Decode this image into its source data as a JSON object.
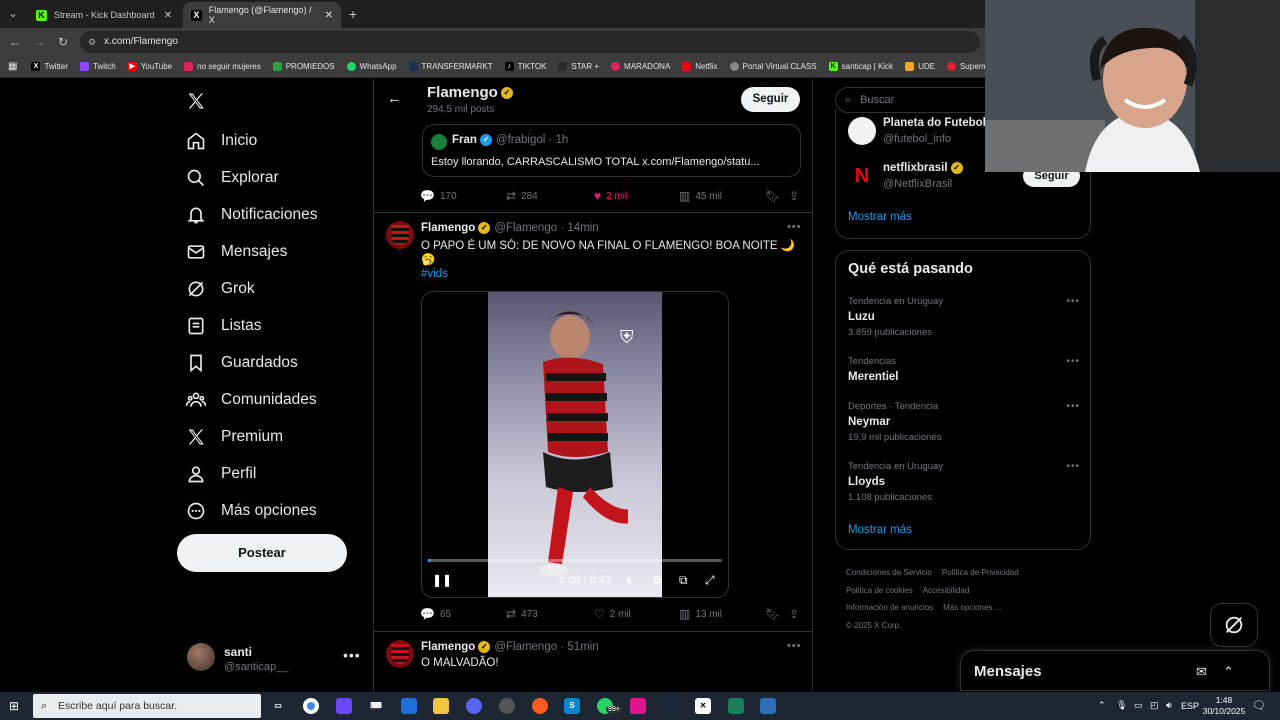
{
  "browser": {
    "tabs": [
      {
        "title": "Stream - Kick Dashboard",
        "active": false
      },
      {
        "title": "Flamengo (@Flamengo) / X",
        "active": true
      }
    ],
    "url": "x.com/Flamengo",
    "bookmarks": [
      "Twitter",
      "Twitch",
      "YouTube",
      "no seguir mujeres",
      "PROMIEDOS",
      "WhatsApp",
      "TRANSFERMARKT",
      "TIKTOK",
      "STAR +",
      "MARADONA",
      "Netflix",
      "Portal Virtual CLASS",
      "santicap | Kick",
      "UDE",
      "Supermat"
    ]
  },
  "nav": {
    "items": [
      "Inicio",
      "Explorar",
      "Notificaciones",
      "Mensajes",
      "Grok",
      "Listas",
      "Guardados",
      "Comunidades",
      "Premium",
      "Perfil",
      "Más opciones"
    ],
    "post_label": "Postear",
    "account": {
      "name": "santi",
      "handle": "@santicap__"
    }
  },
  "profile_header": {
    "name": "Flamengo",
    "posts": "294,5 mil posts",
    "follow_label": "Seguir"
  },
  "quote": {
    "name": "Fran",
    "meta": "@frabigol · 1h",
    "text": "Estoy llorando, CARRASCALISMO TOTAL x.com/Flamengo/statu..."
  },
  "tweet1_actions": {
    "replies": "170",
    "reposts": "284",
    "likes": "2 mil",
    "views": "45 mil"
  },
  "tweet2": {
    "name": "Flamengo",
    "meta": "@Flamengo · 14min",
    "text": "O PAPO É UM SÓ: DE NOVO NA FINAL O FLAMENGO! BOA NOITE 🌙 🥱",
    "hashtag": "#vids",
    "video_time": "0:00 / 0:43",
    "video_progress": 0.01,
    "actions": {
      "replies": "65",
      "reposts": "473",
      "likes": "2 mil",
      "views": "13 mil"
    }
  },
  "tweet3": {
    "name": "Flamengo",
    "meta": "@Flamengo · 51min",
    "text": "O MALVADÃO!"
  },
  "sidebar": {
    "search_placeholder": "Buscar",
    "who_to_follow": [
      {
        "name": "Planeta do Futebol",
        "handle": "@futebol_info"
      },
      {
        "name": "netflixbrasil",
        "handle": "@NetflixBrasil"
      }
    ],
    "follow_label": "Seguir",
    "show_more": "Mostrar más",
    "trends_title": "Qué está pasando",
    "trends": [
      {
        "context": "Tendencia en Uruguay",
        "name": "Luzu",
        "posts": "3.859 publicaciones"
      },
      {
        "context": "Tendencias",
        "name": "Merentiel",
        "posts": ""
      },
      {
        "context": "Deportes · Tendencia",
        "name": "Neymar",
        "posts": "19,9 mil publicaciones"
      },
      {
        "context": "Tendencia en Uruguay",
        "name": "Lloyds",
        "posts": "1.108 publicaciones"
      }
    ],
    "trends_show_more": "Mostrar más",
    "footer": {
      "terms": "Condiciones de Servicio",
      "privacy": "Política de Privacidad",
      "cookies": "Política de cookies",
      "accessibility": "Accesibilidad",
      "ads": "Información de anuncios",
      "more": "Más opciones ...",
      "copyright": "© 2025 X Corp."
    }
  },
  "messages_dock": {
    "title": "Mensajes"
  },
  "taskbar": {
    "search_placeholder": "Escribe aquí para buscar.",
    "lang": "ESP",
    "time": "1:48",
    "date": "30/10/2025",
    "badge": "99+"
  },
  "colors": {
    "accent": "#1d9bf0",
    "verified_gold": "#e2b719",
    "like_pink": "#f91880"
  }
}
